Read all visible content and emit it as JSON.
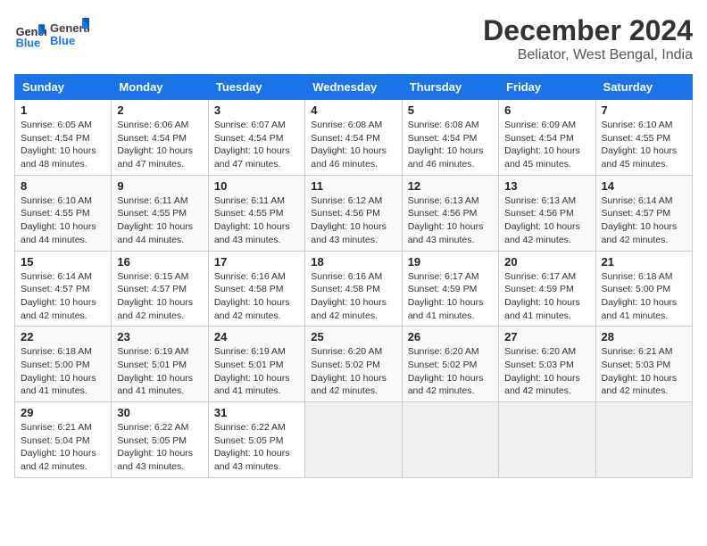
{
  "logo": {
    "line1": "General",
    "line2": "Blue"
  },
  "title": "December 2024",
  "location": "Beliator, West Bengal, India",
  "days_of_week": [
    "Sunday",
    "Monday",
    "Tuesday",
    "Wednesday",
    "Thursday",
    "Friday",
    "Saturday"
  ],
  "weeks": [
    [
      {
        "day": "1",
        "sunrise": "6:05 AM",
        "sunset": "4:54 PM",
        "daylight": "10 hours and 48 minutes."
      },
      {
        "day": "2",
        "sunrise": "6:06 AM",
        "sunset": "4:54 PM",
        "daylight": "10 hours and 47 minutes."
      },
      {
        "day": "3",
        "sunrise": "6:07 AM",
        "sunset": "4:54 PM",
        "daylight": "10 hours and 47 minutes."
      },
      {
        "day": "4",
        "sunrise": "6:08 AM",
        "sunset": "4:54 PM",
        "daylight": "10 hours and 46 minutes."
      },
      {
        "day": "5",
        "sunrise": "6:08 AM",
        "sunset": "4:54 PM",
        "daylight": "10 hours and 46 minutes."
      },
      {
        "day": "6",
        "sunrise": "6:09 AM",
        "sunset": "4:54 PM",
        "daylight": "10 hours and 45 minutes."
      },
      {
        "day": "7",
        "sunrise": "6:10 AM",
        "sunset": "4:55 PM",
        "daylight": "10 hours and 45 minutes."
      }
    ],
    [
      {
        "day": "8",
        "sunrise": "6:10 AM",
        "sunset": "4:55 PM",
        "daylight": "10 hours and 44 minutes."
      },
      {
        "day": "9",
        "sunrise": "6:11 AM",
        "sunset": "4:55 PM",
        "daylight": "10 hours and 44 minutes."
      },
      {
        "day": "10",
        "sunrise": "6:11 AM",
        "sunset": "4:55 PM",
        "daylight": "10 hours and 43 minutes."
      },
      {
        "day": "11",
        "sunrise": "6:12 AM",
        "sunset": "4:56 PM",
        "daylight": "10 hours and 43 minutes."
      },
      {
        "day": "12",
        "sunrise": "6:13 AM",
        "sunset": "4:56 PM",
        "daylight": "10 hours and 43 minutes."
      },
      {
        "day": "13",
        "sunrise": "6:13 AM",
        "sunset": "4:56 PM",
        "daylight": "10 hours and 42 minutes."
      },
      {
        "day": "14",
        "sunrise": "6:14 AM",
        "sunset": "4:57 PM",
        "daylight": "10 hours and 42 minutes."
      }
    ],
    [
      {
        "day": "15",
        "sunrise": "6:14 AM",
        "sunset": "4:57 PM",
        "daylight": "10 hours and 42 minutes."
      },
      {
        "day": "16",
        "sunrise": "6:15 AM",
        "sunset": "4:57 PM",
        "daylight": "10 hours and 42 minutes."
      },
      {
        "day": "17",
        "sunrise": "6:16 AM",
        "sunset": "4:58 PM",
        "daylight": "10 hours and 42 minutes."
      },
      {
        "day": "18",
        "sunrise": "6:16 AM",
        "sunset": "4:58 PM",
        "daylight": "10 hours and 42 minutes."
      },
      {
        "day": "19",
        "sunrise": "6:17 AM",
        "sunset": "4:59 PM",
        "daylight": "10 hours and 41 minutes."
      },
      {
        "day": "20",
        "sunrise": "6:17 AM",
        "sunset": "4:59 PM",
        "daylight": "10 hours and 41 minutes."
      },
      {
        "day": "21",
        "sunrise": "6:18 AM",
        "sunset": "5:00 PM",
        "daylight": "10 hours and 41 minutes."
      }
    ],
    [
      {
        "day": "22",
        "sunrise": "6:18 AM",
        "sunset": "5:00 PM",
        "daylight": "10 hours and 41 minutes."
      },
      {
        "day": "23",
        "sunrise": "6:19 AM",
        "sunset": "5:01 PM",
        "daylight": "10 hours and 41 minutes."
      },
      {
        "day": "24",
        "sunrise": "6:19 AM",
        "sunset": "5:01 PM",
        "daylight": "10 hours and 41 minutes."
      },
      {
        "day": "25",
        "sunrise": "6:20 AM",
        "sunset": "5:02 PM",
        "daylight": "10 hours and 42 minutes."
      },
      {
        "day": "26",
        "sunrise": "6:20 AM",
        "sunset": "5:02 PM",
        "daylight": "10 hours and 42 minutes."
      },
      {
        "day": "27",
        "sunrise": "6:20 AM",
        "sunset": "5:03 PM",
        "daylight": "10 hours and 42 minutes."
      },
      {
        "day": "28",
        "sunrise": "6:21 AM",
        "sunset": "5:03 PM",
        "daylight": "10 hours and 42 minutes."
      }
    ],
    [
      {
        "day": "29",
        "sunrise": "6:21 AM",
        "sunset": "5:04 PM",
        "daylight": "10 hours and 42 minutes."
      },
      {
        "day": "30",
        "sunrise": "6:22 AM",
        "sunset": "5:05 PM",
        "daylight": "10 hours and 43 minutes."
      },
      {
        "day": "31",
        "sunrise": "6:22 AM",
        "sunset": "5:05 PM",
        "daylight": "10 hours and 43 minutes."
      },
      null,
      null,
      null,
      null
    ]
  ]
}
